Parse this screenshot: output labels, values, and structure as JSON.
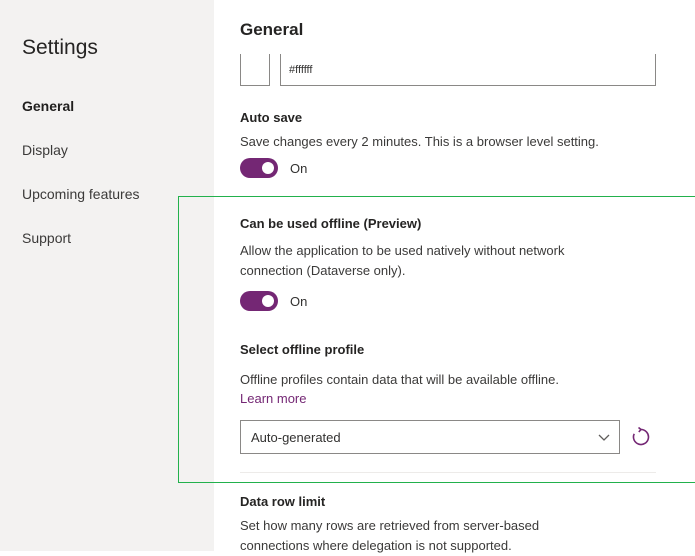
{
  "sidebar": {
    "title": "Settings",
    "items": [
      {
        "label": "General"
      },
      {
        "label": "Display"
      },
      {
        "label": "Upcoming features"
      },
      {
        "label": "Support"
      }
    ]
  },
  "main": {
    "title": "General",
    "color_input": {
      "value": "#ffffff"
    },
    "auto_save": {
      "title": "Auto save",
      "description": "Save changes every 2 minutes. This is a browser level setting.",
      "toggle_label": "On",
      "enabled": true
    },
    "offline": {
      "title": "Can be used offline (Preview)",
      "description_line1": "Allow the application to be used natively without network",
      "description_line2": "connection (Dataverse only).",
      "toggle_label": "On",
      "enabled": true
    },
    "offline_profile": {
      "title": "Select offline profile",
      "description": "Offline profiles contain data that will be available offline.",
      "learn_more": "Learn more",
      "selected": "Auto-generated"
    },
    "data_row_limit": {
      "title": "Data row limit",
      "description_line1": "Set how many rows are retrieved from server-based",
      "description_line2": "connections where delegation is not supported."
    }
  },
  "colors": {
    "accent": "#742774",
    "highlight_box": "#22b14c",
    "sidebar_bg": "#f3f2f1"
  },
  "icons": {
    "dropdown": "chevron-down-icon",
    "refresh": "refresh-icon"
  }
}
